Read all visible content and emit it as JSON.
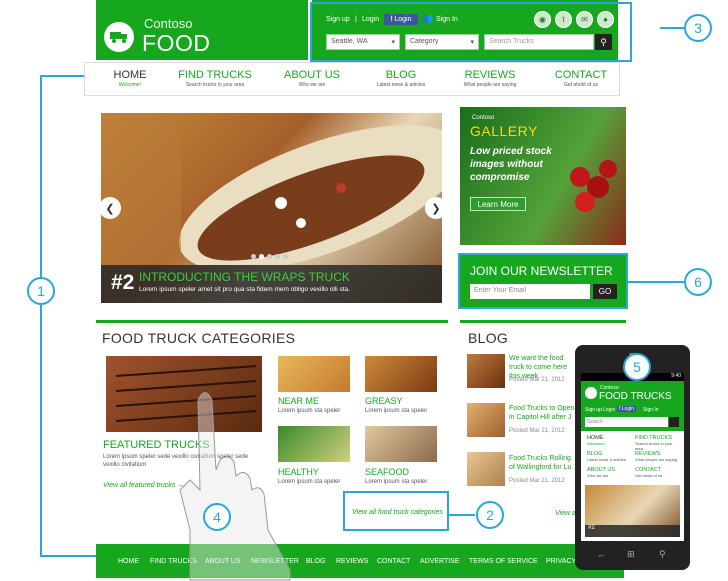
{
  "brand": {
    "small": "Contoso",
    "big": "FOOD TRUCKS"
  },
  "topbar": {
    "signup": "Sign up",
    "sep": "|",
    "login": "Login",
    "facebook": "f Login",
    "signin": "Sign In",
    "location": "Seattle, WA",
    "category": "Category",
    "search_placeholder": "Search Trucks"
  },
  "nav": [
    {
      "title": "HOME",
      "sub": "Welcome!"
    },
    {
      "title": "FIND TRUCKS",
      "sub": "Search trucks in your area"
    },
    {
      "title": "ABOUT US",
      "sub": "Who we are"
    },
    {
      "title": "BLOG",
      "sub": "Latest news & articles"
    },
    {
      "title": "REVIEWS",
      "sub": "What people are saying"
    },
    {
      "title": "CONTACT",
      "sub": "Get ahold of us"
    }
  ],
  "hero": {
    "number": "#2",
    "title": "INTRODUCTING THE WRAPS TRUCK",
    "text": "Lorem ipsum speler amet sit pro qua sta fidem mem obligo vexillo olli sta."
  },
  "gallery": {
    "small": "Contoso",
    "title": "GALLERY",
    "text": "Low priced stock images without compromise",
    "button": "Learn More"
  },
  "newsletter": {
    "title": "JOIN OUR NEWSLETTER",
    "placeholder": "Enter Your Email",
    "button": "GO"
  },
  "categories": {
    "heading": "FOOD TRUCK CATEGORIES",
    "featured": {
      "title": "FEATURED TRUCKS",
      "text": "Lorem ipsum speler sede vexillo civitatium speler sede vexillo civitatium",
      "link": "View all featured trucks →"
    },
    "items": [
      {
        "title": "NEAR ME",
        "sub": "Lorem ipsum sta speler"
      },
      {
        "title": "GREASY",
        "sub": "Lorem ipsum sta speler"
      },
      {
        "title": "HEALTHY",
        "sub": "Lorem ipsum sta speler"
      },
      {
        "title": "SEAFOOD",
        "sub": "Lorem ipsum sta speler"
      }
    ],
    "view_all": "View all food truck categories"
  },
  "blog": {
    "heading": "BLOG",
    "posts": [
      {
        "title": "We want the food truck to come here this week",
        "date": "Posted Mar 21, 2012"
      },
      {
        "title": "Food Trucks to Open in Capitol Hill after J",
        "date": "Posted Mar 21, 2012"
      },
      {
        "title": "Food Trucks Rolling of Wallingford for Lu",
        "date": "Posted Mar 21, 2012"
      }
    ],
    "view_all": "View a"
  },
  "footer": [
    "HOME",
    "FIND TRUCKS",
    "ABOUT US",
    "NEWSLETTER",
    "BLOG",
    "REVIEWS",
    "CONTACT",
    "ADVERTISE",
    "TERMS OF SERVICE",
    "PRIVACY"
  ],
  "callouts": [
    "1",
    "2",
    "3",
    "4",
    "5",
    "6"
  ],
  "phone": {
    "time": "9:40",
    "brand_small": "Contoso",
    "brand_big": "FOOD TRUCKS",
    "signup": "Sign up",
    "login": "Login",
    "facebook": "f Login",
    "signin": "Sign In",
    "search_placeholder": "Search",
    "nav": [
      {
        "title": "HOME",
        "sub": "Welcome!"
      },
      {
        "title": "FIND TRUCKS",
        "sub": "Search trucks in your area"
      },
      {
        "title": "BLOG",
        "sub": "Latest news & articles"
      },
      {
        "title": "REVIEWS",
        "sub": "What people are saying"
      },
      {
        "title": "ABOUT US",
        "sub": "Who we are"
      },
      {
        "title": "CONTACT",
        "sub": "Get ahold of us"
      }
    ],
    "hero_number": "#2"
  },
  "colors": {
    "accent": "#17a71f",
    "callout": "#2aa6d8"
  }
}
